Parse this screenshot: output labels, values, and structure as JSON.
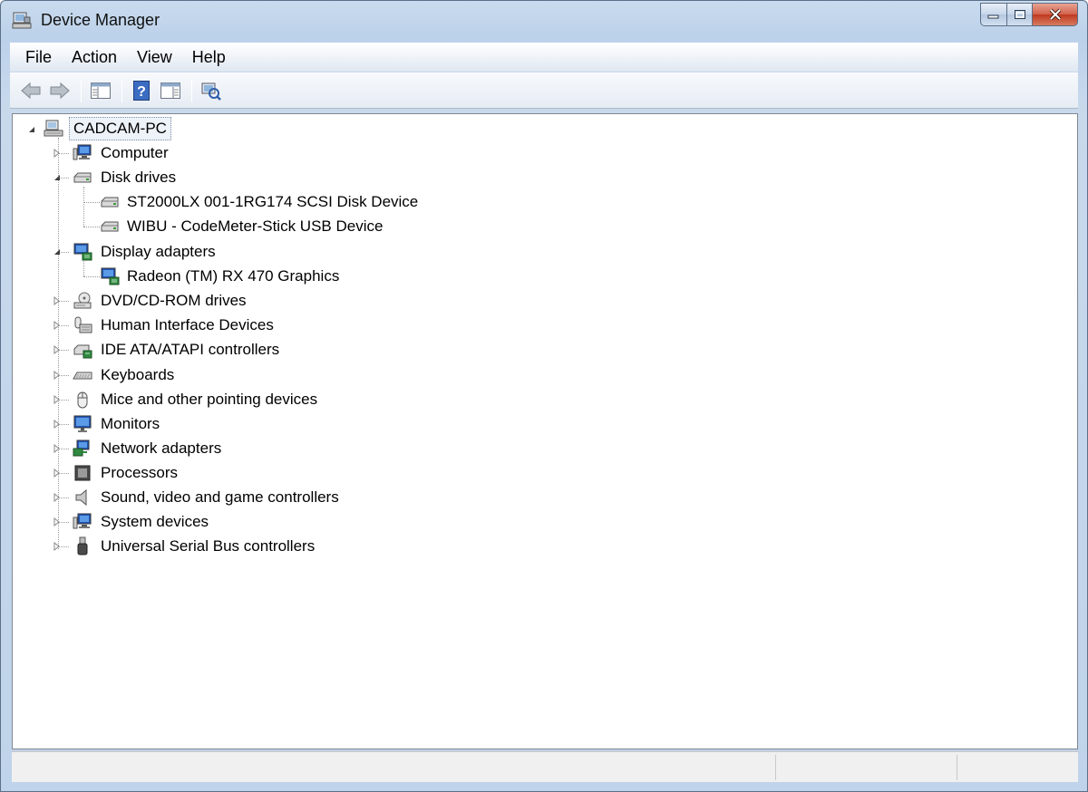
{
  "window": {
    "title": "Device Manager"
  },
  "menu": {
    "items": [
      "File",
      "Action",
      "View",
      "Help"
    ]
  },
  "toolbar": {
    "buttons": [
      "back-arrow-icon",
      "forward-arrow-icon",
      "show-hide-console-tree-icon",
      "help-icon",
      "properties-icon",
      "scan-hardware-icon"
    ]
  },
  "tree": {
    "root": "CADCAM-PC",
    "categories": {
      "computer": "Computer",
      "disk_drives": "Disk drives",
      "display_adapters": "Display adapters",
      "dvd": "DVD/CD-ROM drives",
      "hid": "Human Interface Devices",
      "ide": "IDE ATA/ATAPI controllers",
      "keyboards": "Keyboards",
      "mice": "Mice and other pointing devices",
      "monitors": "Monitors",
      "network": "Network adapters",
      "processors": "Processors",
      "sound": "Sound, video and game controllers",
      "system": "System devices",
      "usb": "Universal Serial Bus controllers"
    },
    "disk_devices": [
      "ST2000LX 001-1RG174 SCSI Disk Device",
      "WIBU - CodeMeter-Stick USB Device"
    ],
    "display_devices": [
      "Radeon (TM) RX 470 Graphics"
    ]
  },
  "colors": {
    "titlebar": "#bcd1ea",
    "close_button": "#c0391f",
    "tree_background": "#ffffff"
  }
}
